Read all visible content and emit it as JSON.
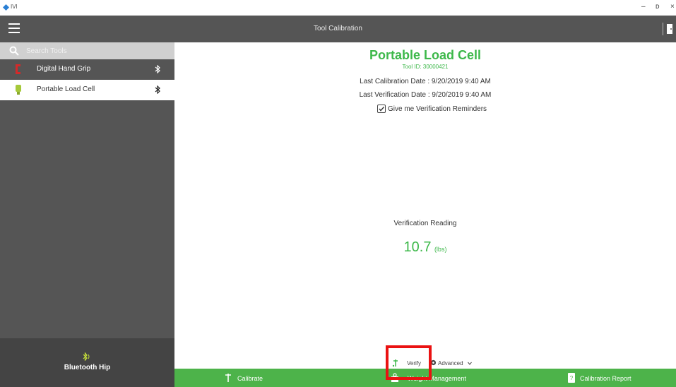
{
  "app": {
    "name": "IVI"
  },
  "window": {
    "minimize": "–",
    "restore": "ᴅ",
    "close": "×"
  },
  "header": {
    "title": "Tool Calibration"
  },
  "sidebar": {
    "search": {
      "placeholder": "Search Tools",
      "value": ""
    },
    "items": [
      {
        "label": "Digital Hand Grip",
        "selected": false
      },
      {
        "label": "Portable Load Cell",
        "selected": true
      }
    ],
    "footer": {
      "label": "Bluetooth Hip"
    }
  },
  "main": {
    "title": "Portable Load Cell",
    "tool_id": "Tool ID: 30000421",
    "last_calibration": "Last Calibration Date :  9/20/2019 9:40 AM",
    "last_verification": "Last Verification Date :  9/20/2019 9:40 AM",
    "reminder_label": "Give me Verification Reminders",
    "reminder_checked": true,
    "reading_label": "Verification Reading",
    "reading_value": "10.7",
    "reading_unit": "(lbs)",
    "verify_label": "Verify",
    "advanced_label": "Advanced"
  },
  "bottom_bar": {
    "calibrate": "Calibrate",
    "weight_management": "Weight Management",
    "calibration_report": "Calibration Report"
  },
  "colors": {
    "header": "#555555",
    "accent_green": "#3db84a",
    "bar_green": "#4db34a",
    "highlight": "#ea1212",
    "grip_red": "#d42a2a",
    "loadcell_green": "#a6c93a"
  }
}
